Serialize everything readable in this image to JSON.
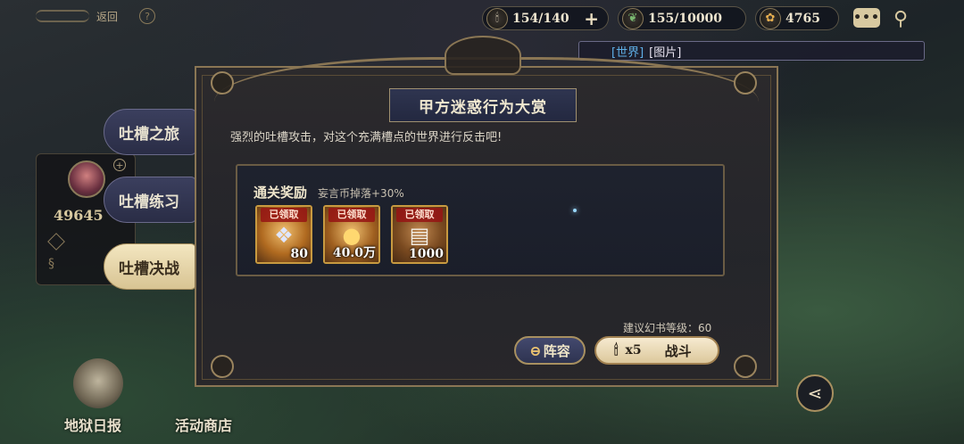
{
  "top_left": {
    "back_label": "返回",
    "help_label": "?"
  },
  "resources": [
    {
      "icon": "candle-icon",
      "value": "154/140",
      "has_plus": true
    },
    {
      "icon": "leaf-icon",
      "value": "155/10000"
    },
    {
      "icon": "coin-icon",
      "value": "4765"
    }
  ],
  "top_right": {
    "chat_icon": "chat-icon",
    "location_icon": "location-pin-icon"
  },
  "chat_ticker": {
    "channel": "[世界]",
    "message": "[图片]"
  },
  "side_card": {
    "power": "49645"
  },
  "tabs": [
    {
      "label": "吐槽之旅",
      "active": false
    },
    {
      "label": "吐槽练习",
      "active": false
    },
    {
      "label": "吐槽决战",
      "active": true
    }
  ],
  "panel": {
    "title": "甲方迷惑行为大赏",
    "subtitle": "强烈的吐槽攻击，对这个充满槽点的世界进行反击吧!",
    "reward_title": "通关奖励",
    "reward_bonus": "妄言币掉落+30%",
    "rewards": [
      {
        "icon": "crystal-feather-icon",
        "status": "已领取",
        "qty": "80"
      },
      {
        "icon": "gold-coin-icon",
        "status": "已领取",
        "qty": "40.0万"
      },
      {
        "icon": "exp-scroll-icon",
        "status": "已领取",
        "qty": "1000"
      }
    ],
    "recommended_level": "建议幻书等级：60",
    "lineup_button": "阵容",
    "battle_cost": "x5",
    "battle_button": "战斗"
  },
  "bottom_left": {
    "daily_label": "地狱日报",
    "shop_label": "活动商店"
  },
  "colors": {
    "accent_gold": "#a89060",
    "panel_bg": "#2c2a2c",
    "active_tab": "#f3e6c0",
    "inactive_tab": "#3b3f5e",
    "channel_blue": "#5fb0e8"
  }
}
